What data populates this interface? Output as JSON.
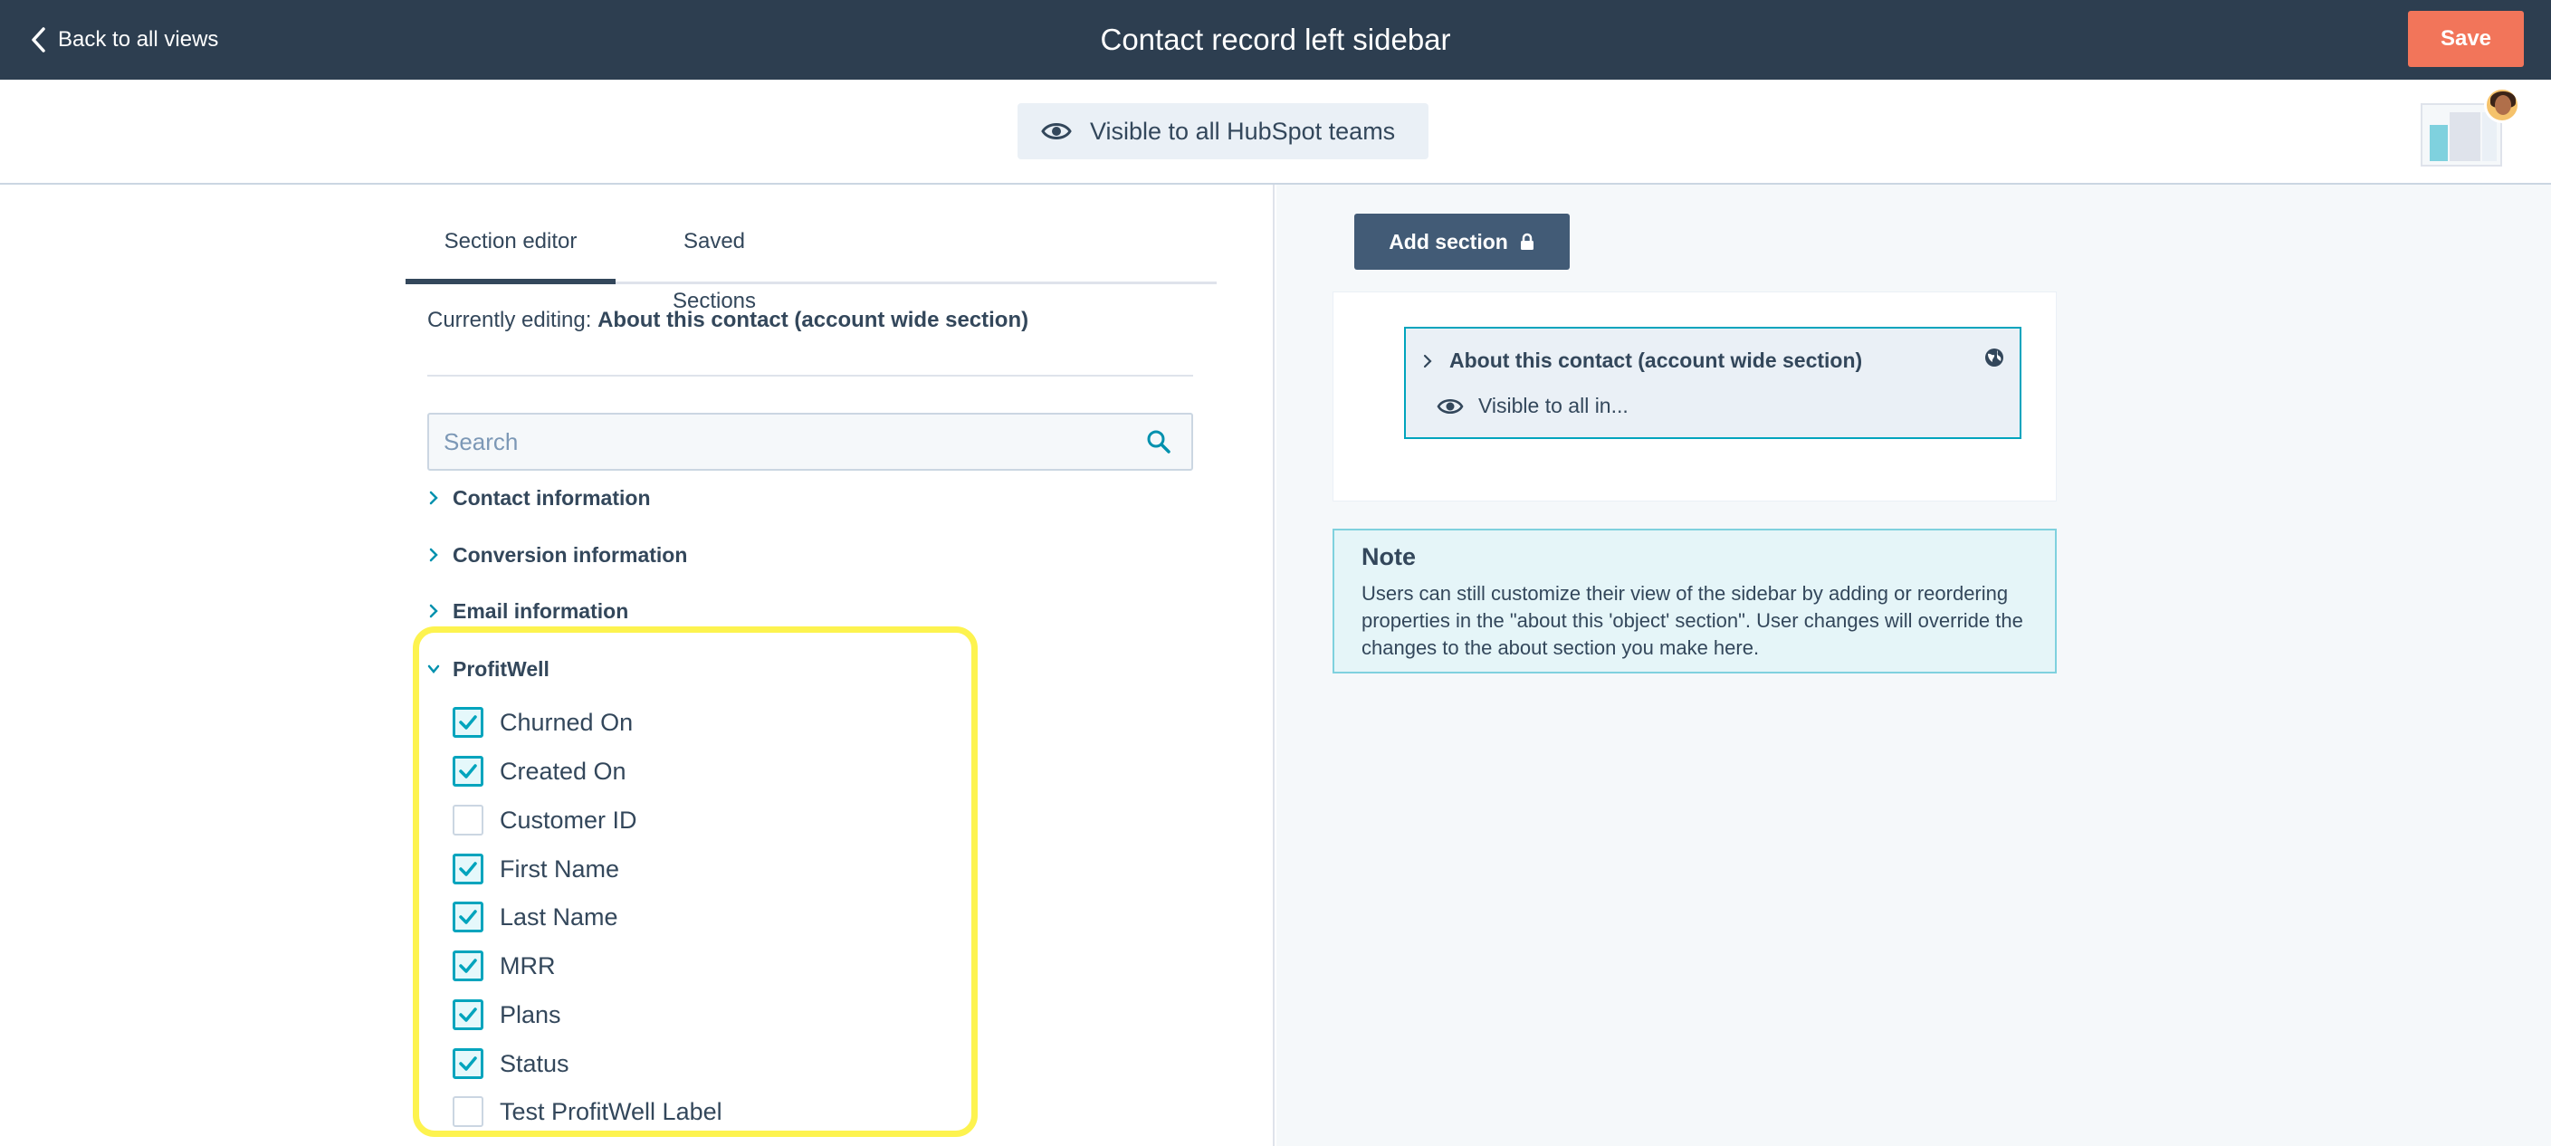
{
  "header": {
    "back_label": "Back to all views",
    "title": "Contact record left sidebar",
    "save_label": "Save"
  },
  "subbar": {
    "visibility_label": "Visible to all HubSpot teams"
  },
  "editor": {
    "tabs": [
      {
        "label": "Section editor",
        "active": true
      },
      {
        "label": "Saved Sections",
        "active": false
      }
    ],
    "editing_prefix": "Currently editing:",
    "editing_section": "About this contact (account wide section)",
    "search_placeholder": "Search",
    "groups": [
      {
        "label": "Contact information",
        "expanded": false
      },
      {
        "label": "Conversion information",
        "expanded": false
      },
      {
        "label": "Email information",
        "expanded": false
      },
      {
        "label": "ProfitWell",
        "expanded": true
      }
    ],
    "properties": [
      {
        "label": "Churned On",
        "checked": true
      },
      {
        "label": "Created On",
        "checked": true
      },
      {
        "label": "Customer ID",
        "checked": false
      },
      {
        "label": "First Name",
        "checked": true
      },
      {
        "label": "Last Name",
        "checked": true
      },
      {
        "label": "MRR",
        "checked": true
      },
      {
        "label": "Plans",
        "checked": true
      },
      {
        "label": "Status",
        "checked": true
      },
      {
        "label": "Test ProfitWell Label",
        "checked": false
      }
    ]
  },
  "preview": {
    "add_section_label": "Add section",
    "section_title": "About this contact (account wide section)",
    "section_visibility": "Visible to all in...",
    "note_title": "Note",
    "note_body": "Users can still customize their view of the sidebar by adding or reordering properties in the \"about this 'object' section\". User changes will override the changes to the about section you make here."
  },
  "colors": {
    "topbar": "#2d3e50",
    "save": "#f2755a",
    "accent": "#00a4bd",
    "highlight": "#fdf34f",
    "add_section": "#425b76"
  },
  "icons": [
    "chevron-left-icon",
    "eye-icon",
    "search-icon",
    "chevron-right-icon",
    "chevron-down-icon",
    "lock-icon",
    "globe-icon",
    "check-icon"
  ]
}
